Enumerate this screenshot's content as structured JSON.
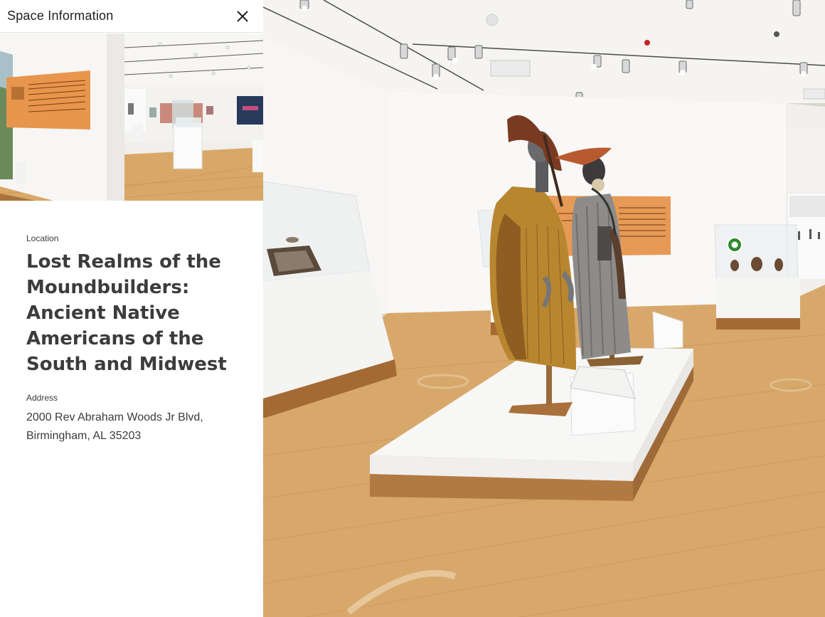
{
  "panel": {
    "title": "Space Information",
    "location_label": "Location",
    "location_name": "Lost Realms of the Moundbuilders: Ancient Native Americans of the South and Midwest",
    "address_label": "Address",
    "address": "2000 Rev Abraham Woods Jr Blvd, Birmingham, AL 35203"
  },
  "icons": {
    "close": "close-icon",
    "tag": "mattertag-icon"
  },
  "colors": {
    "panel_bg": "#ffffff",
    "wall": "#f4f3f1",
    "floor": "#d6a56a",
    "exhibit_sign": "#e79a55",
    "tag_green": "#2e8b2f"
  }
}
